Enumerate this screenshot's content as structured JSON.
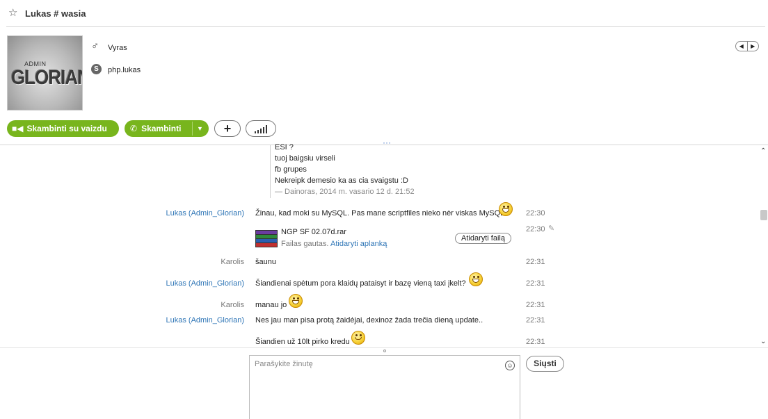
{
  "header": {
    "title": "Lukas # wasia",
    "star_icon": "star-outline-icon"
  },
  "profile": {
    "avatar_text_small": "ADMIN",
    "avatar_text_big": "GLORIAN",
    "gender": "Vyras",
    "gender_icon": "male-icon",
    "skype_name": "php.lukas",
    "skype_icon": "skype-icon"
  },
  "actions": {
    "video_call": "Skambinti su vaizdu",
    "call": "Skambinti",
    "accent": "#78b51d"
  },
  "quote": {
    "lines": [
      "ESI ?",
      "tuoj baigsiu virseli",
      "fb grupes",
      "Nekreipk demesio ka as cia svaigstu :D"
    ],
    "meta": "— Dainoras, 2014 m. vasario 12 d. 21:52"
  },
  "messages": [
    {
      "sender": "Lukas (Admin_Glorian)",
      "text": "Žinau, kad moki su MySQL. Pas mane scriptfiles nieko nėr viskas MySQL.",
      "time": "22:30"
    },
    {
      "sender": "",
      "time": "22:30"
    },
    {
      "sender": "Karolis",
      "text": "šaunu",
      "time": "22:31"
    },
    {
      "sender": "Lukas (Admin_Glorian)",
      "text": "Šiandienai spėtum pora klaidų pataisyt ir bazę vieną taxi įkelt?",
      "time": "22:31"
    },
    {
      "sender": "Karolis",
      "text": "manau jo",
      "time": "22:31"
    },
    {
      "sender": "Lukas (Admin_Glorian)",
      "text": "Nes jau man pisa protą žaidėjai, dexinoz žada trečia dieną update..",
      "time": "22:31"
    },
    {
      "sender": "",
      "text": "Šiandien už 10lt pirko kredu",
      "time": "22:31"
    }
  ],
  "file": {
    "name": "NGP SF 02.07d.rar",
    "status": "Failas gautas.",
    "open_folder": "Atidaryti aplanką",
    "open_file": "Atidaryti failą"
  },
  "compose": {
    "placeholder": "Parašykite žinutę",
    "send": "Siųsti"
  }
}
